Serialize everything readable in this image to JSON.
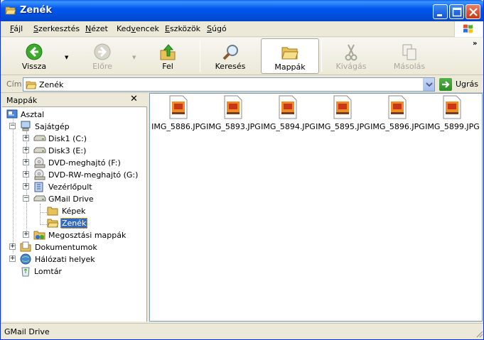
{
  "window": {
    "title": "Zenék"
  },
  "menu": [
    {
      "label": "Fájl",
      "ul": "F",
      "rest": "ájl"
    },
    {
      "label": "Szerkesztés",
      "ul": "S",
      "rest": "zerkesztés"
    },
    {
      "label": "Nézet",
      "ul": "N",
      "rest": "ézet"
    },
    {
      "label": "Kedvencek",
      "ul": "v",
      "pre": "Ked",
      "rest": "encek"
    },
    {
      "label": "Eszközök",
      "ul": "E",
      "rest": "szközök"
    },
    {
      "label": "Súgó",
      "ul": "S",
      "rest": "úgó"
    }
  ],
  "toolbar": {
    "back": "Vissza",
    "forward": "Előre",
    "up": "Fel",
    "search": "Keresés",
    "folders": "Mappák",
    "cut": "Kivágás",
    "copy": "Másolás"
  },
  "address": {
    "label": "Cím",
    "value": "Zenék",
    "go": "Ugrás"
  },
  "folderpane": {
    "title": "Mappák",
    "close": "✕",
    "tree": [
      {
        "label": "Asztal",
        "icon": "desktop-icon"
      },
      {
        "label": "Sajátgép",
        "icon": "computer-icon",
        "exp": "−"
      },
      {
        "label": "Disk1 (C:)",
        "icon": "drive-icon",
        "exp": "+"
      },
      {
        "label": "Disk3 (E:)",
        "icon": "drive-icon",
        "exp": "+"
      },
      {
        "label": "DVD-meghajtó (F:)",
        "icon": "dvd-drive-icon",
        "exp": "+"
      },
      {
        "label": "DVD-RW-meghajtó (G:)",
        "icon": "dvd-drive-icon",
        "exp": "+"
      },
      {
        "label": "Vezérlőpult",
        "icon": "control-panel-icon",
        "exp": "+"
      },
      {
        "label": "GMail Drive",
        "icon": "drive-icon",
        "exp": "−"
      },
      {
        "label": "Képek",
        "icon": "folder-icon"
      },
      {
        "label": "Zenék",
        "icon": "folder-open-icon",
        "selected": true
      },
      {
        "label": "Megosztási mappák",
        "icon": "shared-folder-icon",
        "exp": "+"
      },
      {
        "label": "Dokumentumok",
        "icon": "documents-icon",
        "exp": "+"
      },
      {
        "label": "Hálózati helyek",
        "icon": "network-icon",
        "exp": "+"
      },
      {
        "label": "Lomtár",
        "icon": "recycle-bin-icon"
      }
    ]
  },
  "files": [
    {
      "name": "IMG_5886.JPG"
    },
    {
      "name": "IMG_5893.JPG"
    },
    {
      "name": "IMG_5894.JPG"
    },
    {
      "name": "IMG_5895.JPG"
    },
    {
      "name": "IMG_5896.JPG"
    },
    {
      "name": "IMG_5899.JPG"
    }
  ],
  "status": {
    "text": "GMail Drive"
  },
  "colors": {
    "titlebar": "#0058EE",
    "selection": "#316AC5",
    "chrome": "#ECE9D8"
  }
}
